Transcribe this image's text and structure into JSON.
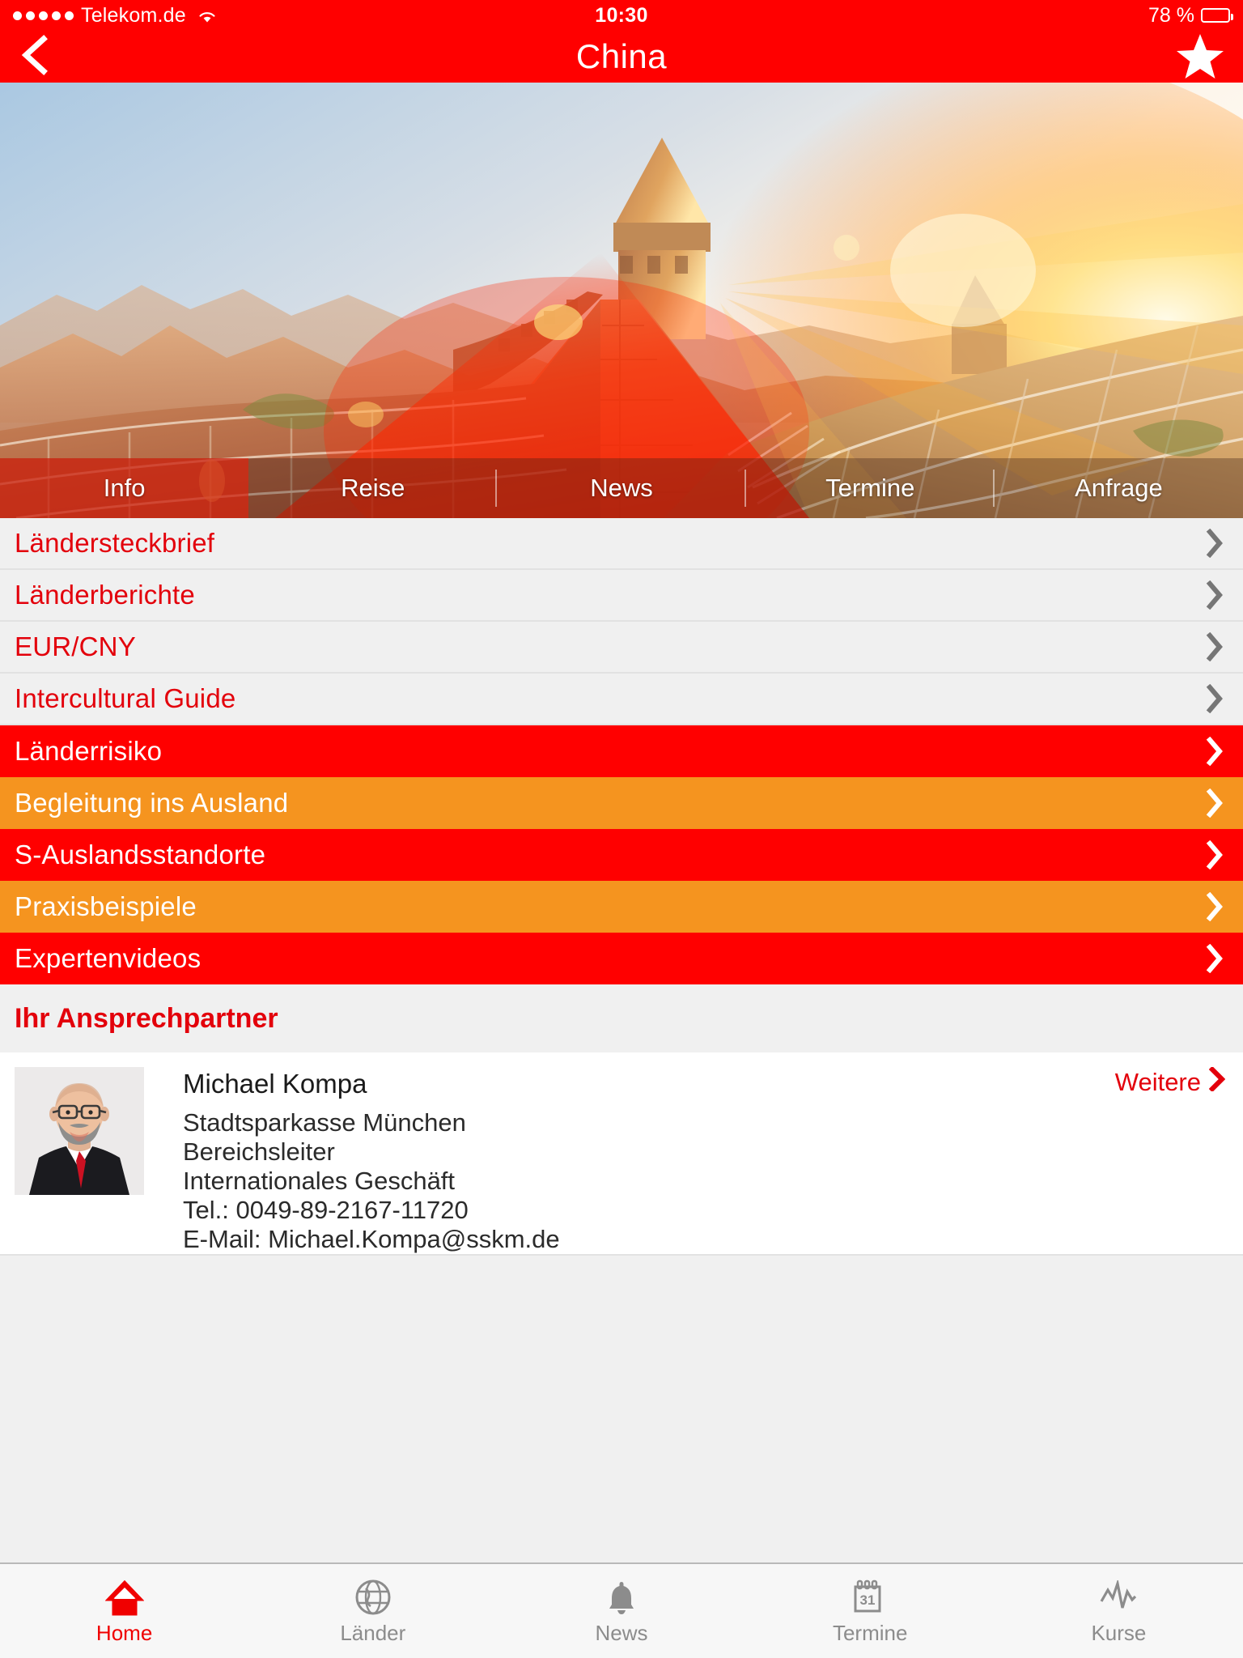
{
  "status_bar": {
    "signal_dots": 5,
    "carrier": "Telekom.de",
    "wifi_icon": "wifi-icon",
    "time": "10:30",
    "battery_label": "78 %",
    "battery_percent": 78
  },
  "nav_bar": {
    "back_icon": "chevron-left-icon",
    "title": "China",
    "favorite_icon": "star-filled-icon"
  },
  "hero": {
    "image_alt": "great-wall-of-china-sunset",
    "tabs": [
      {
        "label": "Info",
        "active": true
      },
      {
        "label": "Reise",
        "active": false
      },
      {
        "label": "News",
        "active": false
      },
      {
        "label": "Termine",
        "active": false
      },
      {
        "label": "Anfrage",
        "active": false
      }
    ]
  },
  "menu": {
    "rows": [
      {
        "label": "Ländersteckbrief",
        "style": "light",
        "chevron": "chevron-right-icon"
      },
      {
        "label": "Länderberichte",
        "style": "light",
        "chevron": "chevron-right-icon"
      },
      {
        "label": "EUR/CNY",
        "style": "light",
        "chevron": "chevron-right-icon"
      },
      {
        "label": "Intercultural Guide",
        "style": "light",
        "chevron": "chevron-right-icon"
      },
      {
        "label": "Länderrisiko",
        "style": "red",
        "chevron": "chevron-right-icon"
      },
      {
        "label": "Begleitung ins Ausland",
        "style": "orange",
        "chevron": "chevron-right-icon"
      },
      {
        "label": "S-Auslandsstandorte",
        "style": "red",
        "chevron": "chevron-right-icon"
      },
      {
        "label": "Praxisbeispiele",
        "style": "orange",
        "chevron": "chevron-right-icon"
      },
      {
        "label": "Expertenvideos",
        "style": "red",
        "chevron": "chevron-right-icon"
      }
    ]
  },
  "contact": {
    "section_title": "Ihr Ansprechpartner",
    "more_label": "Weitere",
    "more_icon": "chevron-right-icon",
    "avatar_alt": "portrait-michael-kompa",
    "name": "Michael Kompa",
    "lines": [
      "Stadtsparkasse München",
      "Bereichsleiter",
      "Internationales Geschäft",
      "Tel.: 0049-89-2167-11720",
      "E-Mail: Michael.Kompa@sskm.de"
    ]
  },
  "tab_bar": {
    "items": [
      {
        "label": "Home",
        "icon": "home-icon",
        "active": true
      },
      {
        "label": "Länder",
        "icon": "globe-icon",
        "active": false
      },
      {
        "label": "News",
        "icon": "bell-icon",
        "active": false
      },
      {
        "label": "Termine",
        "icon": "calendar-icon",
        "active": false
      },
      {
        "label": "Kurse",
        "icon": "pulse-chart-icon",
        "active": false
      }
    ],
    "calendar_day": "31"
  },
  "colors": {
    "brand_red": "#FF0000",
    "accent_red": "#E3000B",
    "accent_orange": "#F5941F",
    "list_bg": "#F0F0F0",
    "tabbar_bg": "#F7F7F7",
    "inactive_gray": "#8C8C8C"
  }
}
